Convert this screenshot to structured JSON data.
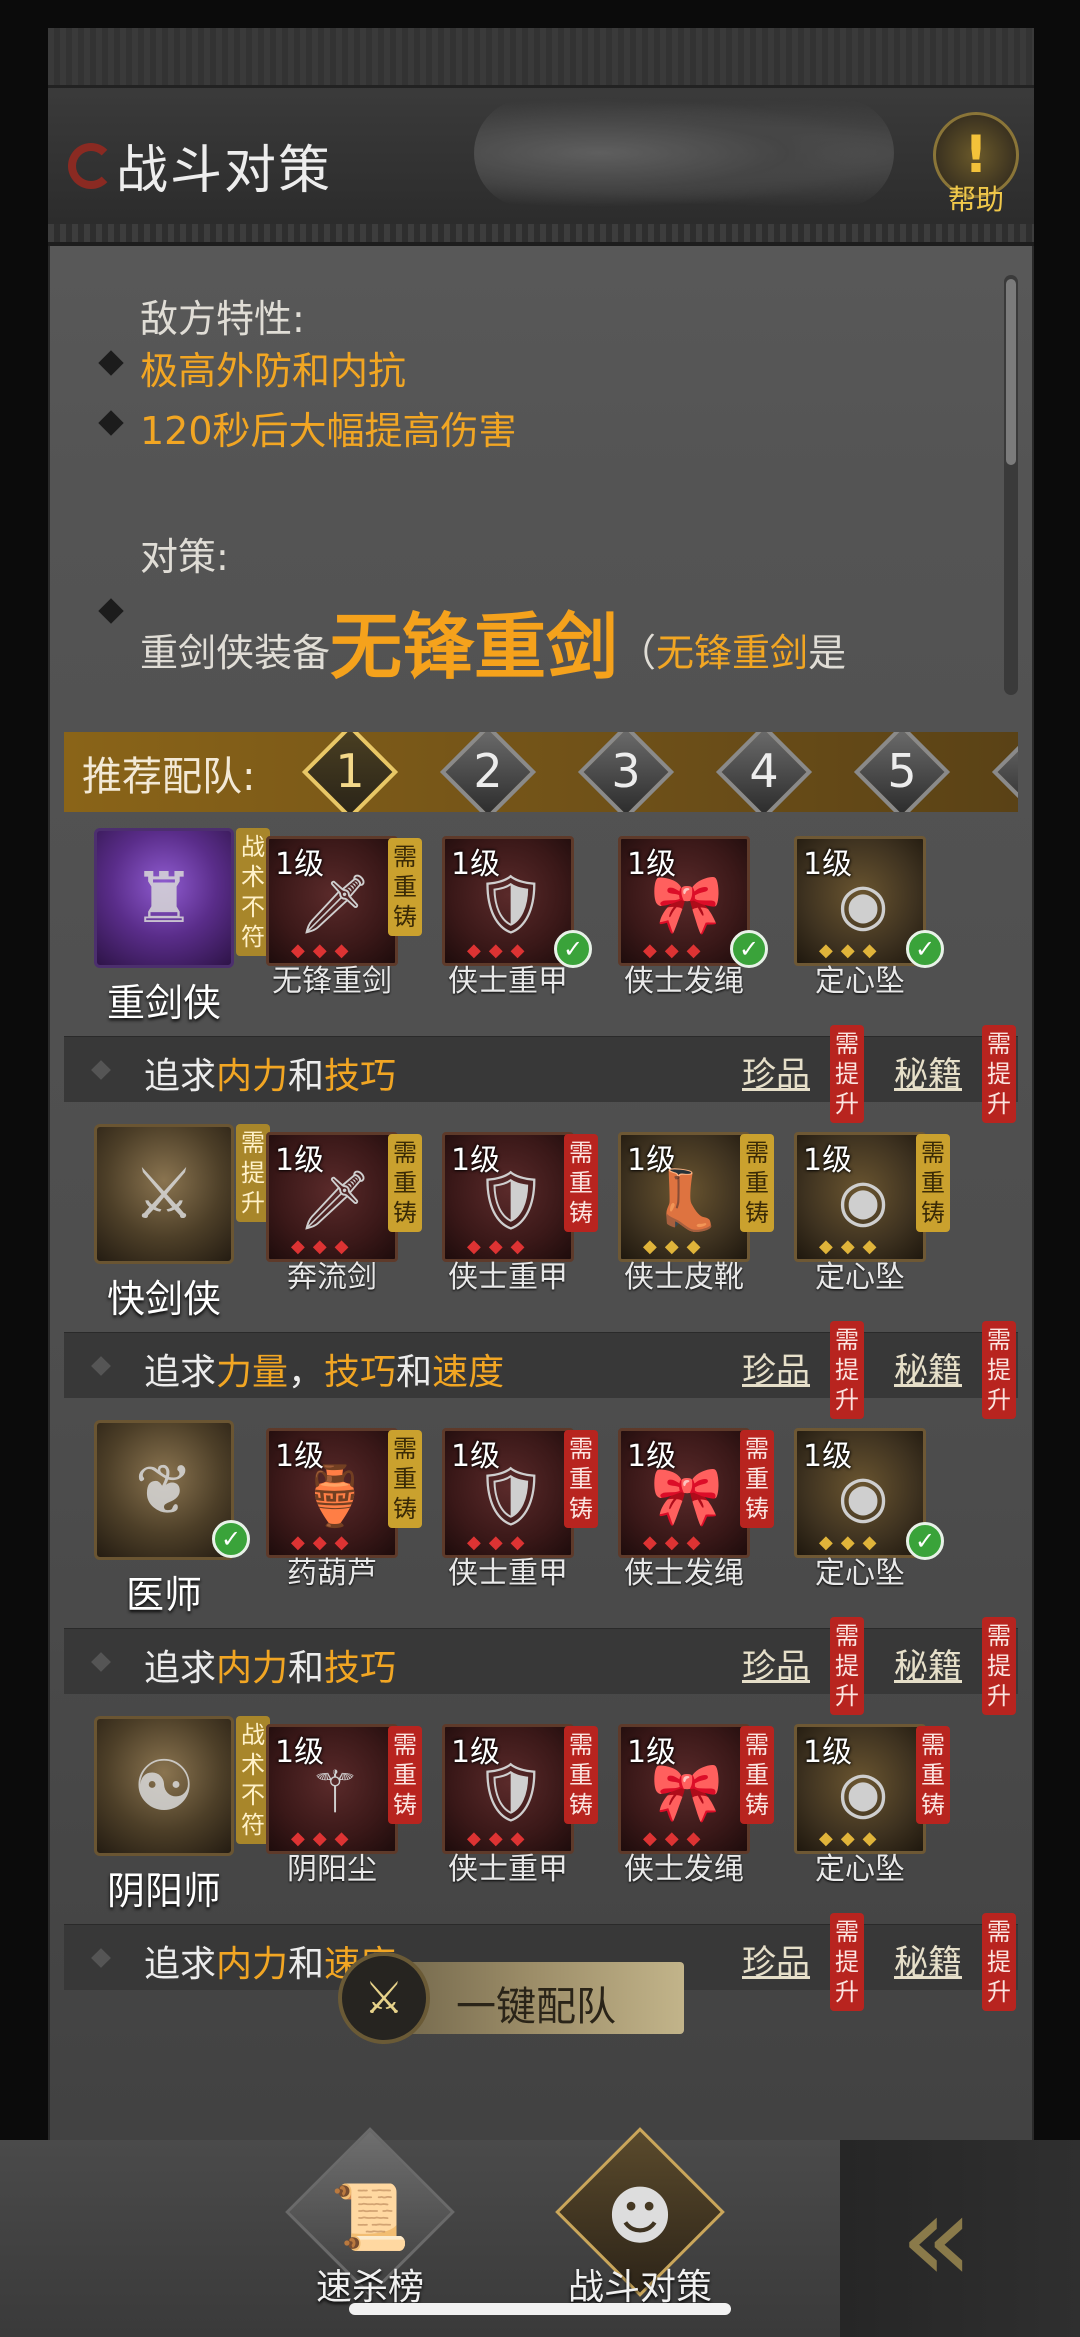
{
  "header": {
    "title": "战斗对策",
    "help_label": "帮助",
    "help_icon": "exclamation-icon"
  },
  "info": {
    "enemy_traits_label": "敌方特性:",
    "traits": [
      "极高外防和内抗",
      "120秒后大幅提高伤害"
    ],
    "counter_label": "对策:",
    "counter_prefix": "重剑侠装备",
    "counter_weapon": "无锋重剑",
    "counter_paren_open": "（",
    "counter_paren_weapon": "无锋重剑",
    "counter_paren_tail": "是"
  },
  "recommend": {
    "label": "推荐配队:",
    "tabs": [
      "1",
      "2",
      "3",
      "4",
      "5"
    ],
    "active_tab": "1"
  },
  "teams": [
    {
      "hero": "重剑侠",
      "hero_tag": "战术不符",
      "hero_icon": "shield-crest-icon",
      "items": [
        {
          "level": "1级",
          "name": "无锋重剑",
          "status": "需重铸",
          "icon": "sword-icon"
        },
        {
          "level": "1级",
          "name": "侠士重甲",
          "status": "check",
          "icon": "armor-icon"
        },
        {
          "level": "1级",
          "name": "侠士发绳",
          "status": "check",
          "icon": "hair-ribbon-icon"
        },
        {
          "level": "1级",
          "name": "定心坠",
          "status": "check",
          "icon": "pendant-icon"
        }
      ],
      "pursue_prefix": "追求",
      "pursue_a": "内力",
      "pursue_sep": "和",
      "pursue_b": "技巧",
      "pursue_sep2": "",
      "pursue_c": "",
      "treasure": "珍品",
      "treasure_tag": "需提升",
      "manual": "秘籍",
      "manual_tag": "需提升"
    },
    {
      "hero": "快剑侠",
      "hero_tag": "需提升",
      "hero_icon": "blade-crest-icon",
      "items": [
        {
          "level": "1级",
          "name": "奔流剑",
          "status": "需重铸",
          "icon": "sword-icon"
        },
        {
          "level": "1级",
          "name": "侠士重甲",
          "status": "需重铸",
          "icon": "armor-icon"
        },
        {
          "level": "1级",
          "name": "侠士皮靴",
          "status": "需重铸",
          "icon": "boots-icon"
        },
        {
          "level": "1级",
          "name": "定心坠",
          "status": "需重铸",
          "icon": "pendant-icon"
        }
      ],
      "pursue_prefix": "追求",
      "pursue_a": "力量",
      "pursue_sep": "，",
      "pursue_b": "技巧",
      "pursue_sep2": "和",
      "pursue_c": "速度",
      "treasure": "珍品",
      "treasure_tag": "需提升",
      "manual": "秘籍",
      "manual_tag": "需提升"
    },
    {
      "hero": "医师",
      "hero_tag": "",
      "hero_icon": "leaf-crest-icon",
      "items": [
        {
          "level": "1级",
          "name": "药葫芦",
          "status": "需重铸",
          "icon": "gourd-icon"
        },
        {
          "level": "1级",
          "name": "侠士重甲",
          "status": "需重铸",
          "icon": "armor-icon"
        },
        {
          "level": "1级",
          "name": "侠士发绳",
          "status": "需重铸",
          "icon": "hair-ribbon-icon"
        },
        {
          "level": "1级",
          "name": "定心坠",
          "status": "check",
          "icon": "pendant-icon"
        }
      ],
      "pursue_prefix": "追求",
      "pursue_a": "内力",
      "pursue_sep": "和",
      "pursue_b": "技巧",
      "pursue_sep2": "",
      "pursue_c": "",
      "treasure": "珍品",
      "treasure_tag": "需提升",
      "manual": "秘籍",
      "manual_tag": "需提升"
    },
    {
      "hero": "阴阳师",
      "hero_tag": "战术不符",
      "hero_icon": "yin-yang-crest-icon",
      "items": [
        {
          "level": "1级",
          "name": "阴阳尘",
          "status": "需重铸",
          "icon": "whisk-icon"
        },
        {
          "level": "1级",
          "name": "侠士重甲",
          "status": "需重铸",
          "icon": "armor-icon"
        },
        {
          "level": "1级",
          "name": "侠士发绳",
          "status": "需重铸",
          "icon": "hair-ribbon-icon"
        },
        {
          "level": "1级",
          "name": "定心坠",
          "status": "需重铸",
          "icon": "pendant-icon"
        }
      ],
      "pursue_prefix": "追求",
      "pursue_a": "内力",
      "pursue_sep": "和",
      "pursue_b": "速度",
      "pursue_sep2": "",
      "pursue_c": "",
      "treasure": "珍品",
      "treasure_tag": "需提升",
      "manual": "秘籍",
      "manual_tag": "需提升"
    }
  ],
  "one_click": {
    "label": "一键配队",
    "icon": "shield-sword-icon"
  },
  "tabbar": [
    {
      "label": "速杀榜",
      "icon": "scroll-icon"
    },
    {
      "label": "战斗对策",
      "icon": "mask-figure-icon"
    }
  ],
  "back_icon": "double-chevron-left-icon",
  "colors": {
    "accent": "#f2a623",
    "tag_yellow": "#caa12e",
    "tag_red": "#b8241f",
    "check_green": "#3aa33a"
  }
}
